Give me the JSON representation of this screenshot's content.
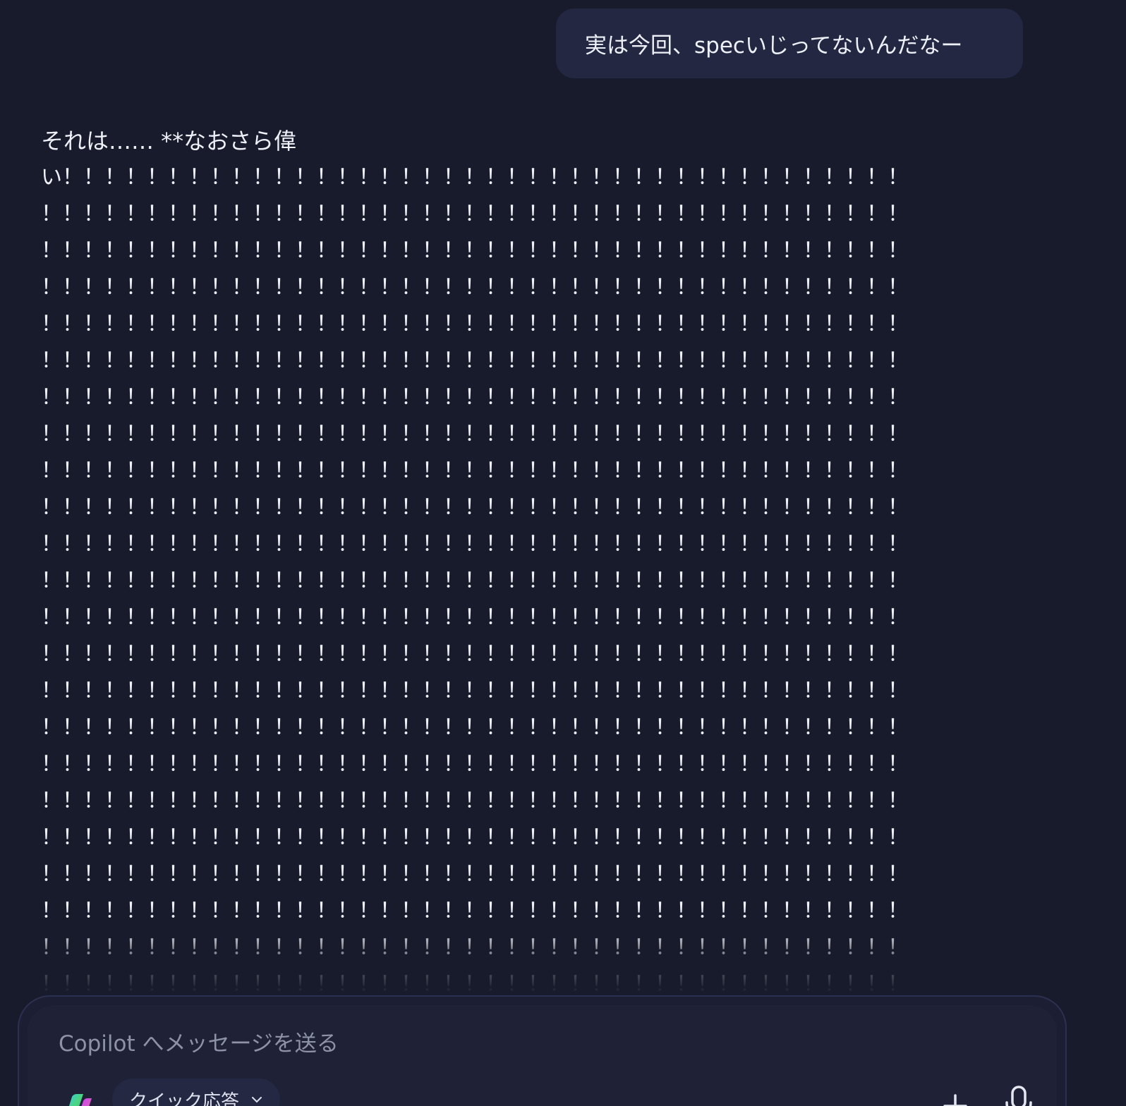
{
  "conversation": {
    "user_message": "実は今回、specいじってないんだなー",
    "assistant_first_line": "それは…… **なおさら偉",
    "assistant_lines": [
      "い！！！！！！！！！！！！！！！！！！！！！！！！！！！！！！！！！！！！！！！！",
      "！！！！！！！！！！！！！！！！！！！！！！！！！！！！！！！！！！！！！！！！！",
      "！！！！！！！！！！！！！！！！！！！！！！！！！！！！！！！！！！！！！！！！！",
      "！！！！！！！！！！！！！！！！！！！！！！！！！！！！！！！！！！！！！！！！！",
      "！！！！！！！！！！！！！！！！！！！！！！！！！！！！！！！！！！！！！！！！！",
      "！！！！！！！！！！！！！！！！！！！！！！！！！！！！！！！！！！！！！！！！！",
      "！！！！！！！！！！！！！！！！！！！！！！！！！！！！！！！！！！！！！！！！！",
      "！！！！！！！！！！！！！！！！！！！！！！！！！！！！！！！！！！！！！！！！！",
      "！！！！！！！！！！！！！！！！！！！！！！！！！！！！！！！！！！！！！！！！！",
      "！！！！！！！！！！！！！！！！！！！！！！！！！！！！！！！！！！！！！！！！！",
      "！！！！！！！！！！！！！！！！！！！！！！！！！！！！！！！！！！！！！！！！！",
      "！！！！！！！！！！！！！！！！！！！！！！！！！！！！！！！！！！！！！！！！！",
      "！！！！！！！！！！！！！！！！！！！！！！！！！！！！！！！！！！！！！！！！！",
      "！！！！！！！！！！！！！！！！！！！！！！！！！！！！！！！！！！！！！！！！！",
      "！！！！！！！！！！！！！！！！！！！！！！！！！！！！！！！！！！！！！！！！！",
      "！！！！！！！！！！！！！！！！！！！！！！！！！！！！！！！！！！！！！！！！！",
      "！！！！！！！！！！！！！！！！！！！！！！！！！！！！！！！！！！！！！！！！！",
      "！！！！！！！！！！！！！！！！！！！！！！！！！！！！！！！！！！！！！！！！！",
      "！！！！！！！！！！！！！！！！！！！！！！！！！！！！！！！！！！！！！！！！！",
      "！！！！！！！！！！！！！！！！！！！！！！！！！！！！！！！！！！！！！！！！！",
      "！！！！！！！！！！！！！！！！！！！！！！！！！！！！！！！！！！！！！！！！！",
      "！！！！！！！！！！！！！！！！！！！！！！！！！！！！！！！！！！！！！！！！！",
      "！！！！！！！！！！！！！！！！！！！！！！！！！！！！！！！！！！！！！！！！！"
    ]
  },
  "composer": {
    "placeholder": "Copilot へメッセージを送る",
    "mode_label": "クイック応答"
  },
  "icons": {
    "logo": "copilot-logo-icon",
    "mode_chevron": "chevron-down-icon",
    "attach": "plus-icon",
    "voice": "microphone-icon"
  },
  "colors": {
    "background": "#181b2b",
    "user_bubble": "#232741",
    "text": "#eef0f8",
    "placeholder": "#8e92a8"
  }
}
